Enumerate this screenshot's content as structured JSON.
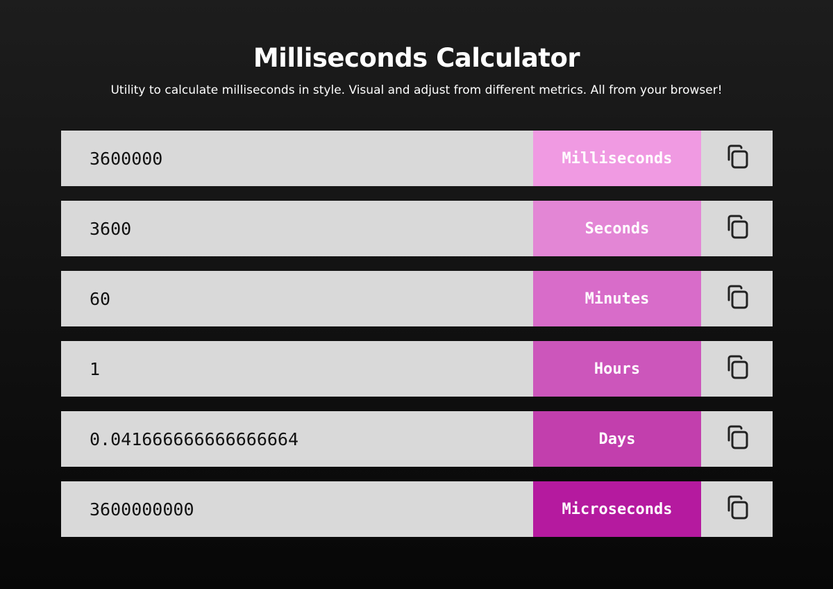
{
  "header": {
    "title": "Milliseconds Calculator",
    "subtitle": "Utility to calculate milliseconds in style. Visual and adjust from different metrics. All from your browser!"
  },
  "rows": [
    {
      "value": "3600000",
      "unit": "Milliseconds",
      "color": "#f09ae2",
      "icon": "copy-icon"
    },
    {
      "value": "3600",
      "unit": "Seconds",
      "color": "#e386d5",
      "icon": "copy-icon"
    },
    {
      "value": "60",
      "unit": "Minutes",
      "color": "#d86cc9",
      "icon": "copy-icon"
    },
    {
      "value": "1",
      "unit": "Hours",
      "color": "#cc56bb",
      "icon": "copy-icon"
    },
    {
      "value": "0.041666666666666664",
      "unit": "Days",
      "color": "#c23fad",
      "icon": "copy-icon"
    },
    {
      "value": "3600000000",
      "unit": "Microseconds",
      "color": "#b51a9f",
      "icon": "copy-icon"
    }
  ]
}
